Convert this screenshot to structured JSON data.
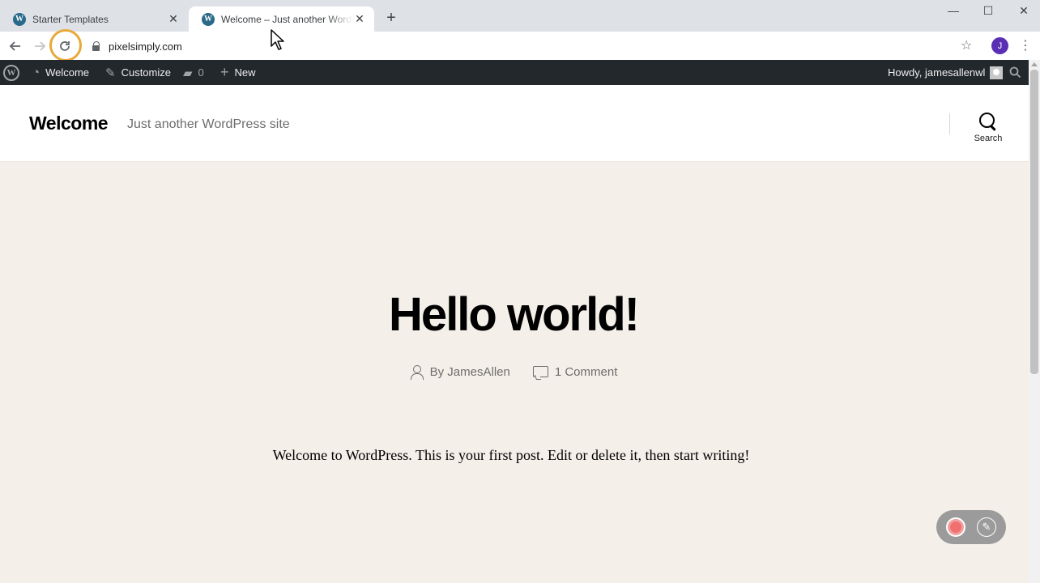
{
  "browser": {
    "tabs": [
      {
        "title": "Starter Templates",
        "active": false,
        "favicon": "wordpress-icon"
      },
      {
        "title": "Welcome – Just another WordPress site",
        "active": true,
        "favicon": "wordpress-icon"
      }
    ],
    "new_tab_glyph": "+",
    "window_controls": {
      "minimize": "—",
      "maximize": "☐",
      "close": "✕"
    },
    "url": "pixelsimply.com",
    "profile_initial": "J",
    "icons": {
      "back": "arrow-left-icon",
      "forward": "arrow-right-icon",
      "reload": "reload-icon",
      "secure": "lock-icon",
      "bookmark": "star-icon",
      "menu": "kebab-menu-icon"
    }
  },
  "admin_bar": {
    "site_name": "Welcome",
    "customize": "Customize",
    "comments_count": "0",
    "new": "New",
    "howdy": "Howdy, jamesallenwl"
  },
  "site": {
    "title": "Welcome",
    "description": "Just another WordPress site",
    "search_label": "Search"
  },
  "post": {
    "title": "Hello world!",
    "author": "By JamesAllen",
    "comments": "1 Comment",
    "content": "Welcome to WordPress. This is your first post. Edit or delete it, then start writing!"
  },
  "colors": {
    "admin_bar_bg": "#23282d",
    "content_bg": "#f5efe9",
    "highlight_ring": "#e8a93a",
    "profile_avatar": "#5b2fb4"
  }
}
